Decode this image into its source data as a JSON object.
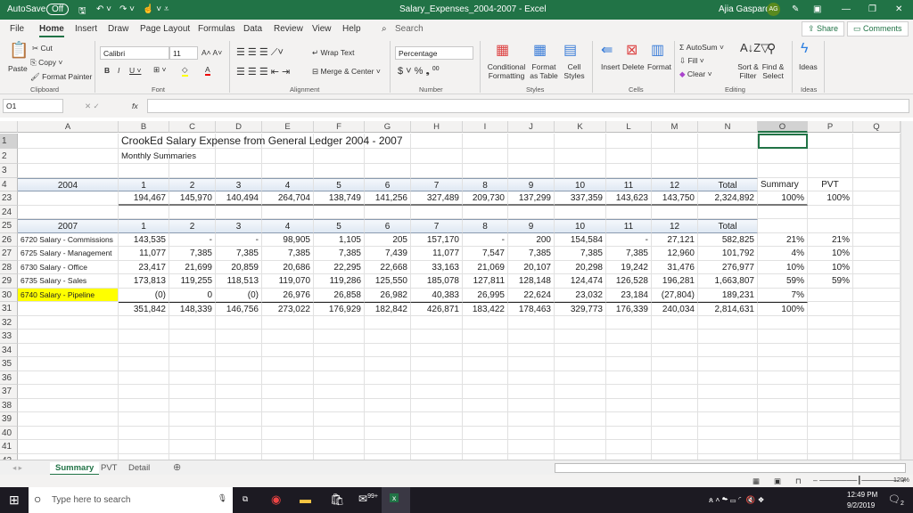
{
  "titlebar": {
    "autosave": "AutoSave",
    "autosave_state": "Off",
    "title": "Salary_Expenses_2004-2007  -  Excel",
    "user": "Ajia Gaspard",
    "initials": "AG"
  },
  "menu": {
    "tabs": [
      "File",
      "Home",
      "Insert",
      "Draw",
      "Page Layout",
      "Formulas",
      "Data",
      "Review",
      "View",
      "Help"
    ],
    "search": "Search",
    "share": "Share",
    "comments": "Comments"
  },
  "ribbon": {
    "paste": "Paste",
    "cut": "Cut",
    "copy": "Copy",
    "format_painter": "Format Painter",
    "clipboard": "Clipboard",
    "font_name": "Calibri",
    "font_size": "11",
    "font": "Font",
    "wrap_text": "Wrap Text",
    "merge_center": "Merge & Center",
    "alignment": "Alignment",
    "number_format": "Percentage",
    "number": "Number",
    "conditional": "Conditional Formatting",
    "format_table": "Format as Table",
    "cell_styles": "Cell Styles",
    "styles": "Styles",
    "insert": "Insert",
    "delete": "Delete",
    "format": "Format",
    "cells": "Cells",
    "autosum": "AutoSum",
    "fill": "Fill",
    "clear": "Clear",
    "sort_filter": "Sort & Filter",
    "find_select": "Find & Select",
    "editing": "Editing",
    "ideas": "Ideas",
    "ideas_group": "Ideas"
  },
  "formula_bar": {
    "name_box": "O1",
    "fx": "fx",
    "formula": ""
  },
  "sheet": {
    "columns": [
      "A",
      "B",
      "C",
      "D",
      "E",
      "F",
      "G",
      "H",
      "I",
      "J",
      "K",
      "L",
      "M",
      "N",
      "O",
      "P",
      "Q"
    ],
    "rows": [
      {
        "n": "1",
        "cells": {
          "B": "CrookEd Salary Expense from General Ledger 2004 - 2007"
        }
      },
      {
        "n": "2",
        "cells": {
          "B": "Monthly Summaries"
        }
      },
      {
        "n": "3",
        "cells": {}
      },
      {
        "n": "4",
        "cells": {
          "A": "2004",
          "B": "1",
          "C": "2",
          "D": "3",
          "E": "4",
          "F": "5",
          "G": "6",
          "H": "7",
          "I": "8",
          "J": "9",
          "K": "10",
          "L": "11",
          "M": "12",
          "N": "Total",
          "O": "Summary",
          "P": "PVT"
        }
      },
      {
        "n": "23",
        "cells": {
          "B": "194,467",
          "C": "145,970",
          "D": "140,494",
          "E": "264,704",
          "F": "138,749",
          "G": "141,256",
          "H": "327,489",
          "I": "209,730",
          "J": "137,299",
          "K": "337,359",
          "L": "143,623",
          "M": "143,750",
          "N": "2,324,892",
          "O": "100%",
          "P": "100%"
        }
      },
      {
        "n": "24",
        "cells": {}
      },
      {
        "n": "25",
        "cells": {
          "A": "2007",
          "B": "1",
          "C": "2",
          "D": "3",
          "E": "4",
          "F": "5",
          "G": "6",
          "H": "7",
          "I": "8",
          "J": "9",
          "K": "10",
          "L": "11",
          "M": "12",
          "N": "Total"
        }
      },
      {
        "n": "26",
        "cells": {
          "A": "6720 Salary - Commissions",
          "B": "143,535",
          "C": "-",
          "D": "-",
          "E": "98,905",
          "F": "1,105",
          "G": "205",
          "H": "157,170",
          "I": "-",
          "J": "200",
          "K": "154,584",
          "L": "-",
          "M": "27,121",
          "N": "582,825",
          "O": "21%",
          "P": "21%"
        }
      },
      {
        "n": "27",
        "cells": {
          "A": "6725 Salary - Management",
          "B": "11,077",
          "C": "7,385",
          "D": "7,385",
          "E": "7,385",
          "F": "7,385",
          "G": "7,439",
          "H": "11,077",
          "I": "7,547",
          "J": "7,385",
          "K": "7,385",
          "L": "7,385",
          "M": "12,960",
          "N": "101,792",
          "O": "4%",
          "P": "10%"
        }
      },
      {
        "n": "28",
        "cells": {
          "A": "6730 Salary - Office",
          "B": "23,417",
          "C": "21,699",
          "D": "20,859",
          "E": "20,686",
          "F": "22,295",
          "G": "22,668",
          "H": "33,163",
          "I": "21,069",
          "J": "20,107",
          "K": "20,298",
          "L": "19,242",
          "M": "31,476",
          "N": "276,977",
          "O": "10%",
          "P": "10%"
        }
      },
      {
        "n": "29",
        "cells": {
          "A": "6735 Salary - Sales",
          "B": "173,813",
          "C": "119,255",
          "D": "118,513",
          "E": "119,070",
          "F": "119,286",
          "G": "125,550",
          "H": "185,078",
          "I": "127,811",
          "J": "128,148",
          "K": "124,474",
          "L": "126,528",
          "M": "196,281",
          "N": "1,663,807",
          "O": "59%",
          "P": "59%"
        }
      },
      {
        "n": "30",
        "cells": {
          "A": "6740 Salary - Pipeline",
          "B": "(0)",
          "C": "0",
          "D": "(0)",
          "E": "26,976",
          "F": "26,858",
          "G": "26,982",
          "H": "40,383",
          "I": "26,995",
          "J": "22,624",
          "K": "23,032",
          "L": "23,184",
          "M": "(27,804)",
          "N": "189,231",
          "O": "7%"
        }
      },
      {
        "n": "31",
        "cells": {
          "B": "351,842",
          "C": "148,339",
          "D": "146,756",
          "E": "273,022",
          "F": "176,929",
          "G": "182,842",
          "H": "426,871",
          "I": "183,422",
          "J": "178,463",
          "K": "329,773",
          "L": "176,339",
          "M": "240,034",
          "N": "2,814,631",
          "O": "100%"
        }
      },
      {
        "n": "32",
        "cells": {}
      },
      {
        "n": "33",
        "cells": {}
      },
      {
        "n": "34",
        "cells": {}
      },
      {
        "n": "35",
        "cells": {}
      },
      {
        "n": "36",
        "cells": {}
      },
      {
        "n": "37",
        "cells": {}
      },
      {
        "n": "38",
        "cells": {}
      },
      {
        "n": "39",
        "cells": {}
      },
      {
        "n": "40",
        "cells": {}
      },
      {
        "n": "41",
        "cells": {}
      },
      {
        "n": "42",
        "cells": {}
      }
    ],
    "highlight_color": "#ffff00"
  },
  "sheet_tabs": [
    "Summary",
    "PVT",
    "Detail"
  ],
  "status": {
    "zoom": "120%"
  },
  "taskbar": {
    "search": "Type here to search",
    "time": "12:49 PM",
    "date": "9/2/2019",
    "notifications": "2",
    "mail_badge": "99+"
  }
}
